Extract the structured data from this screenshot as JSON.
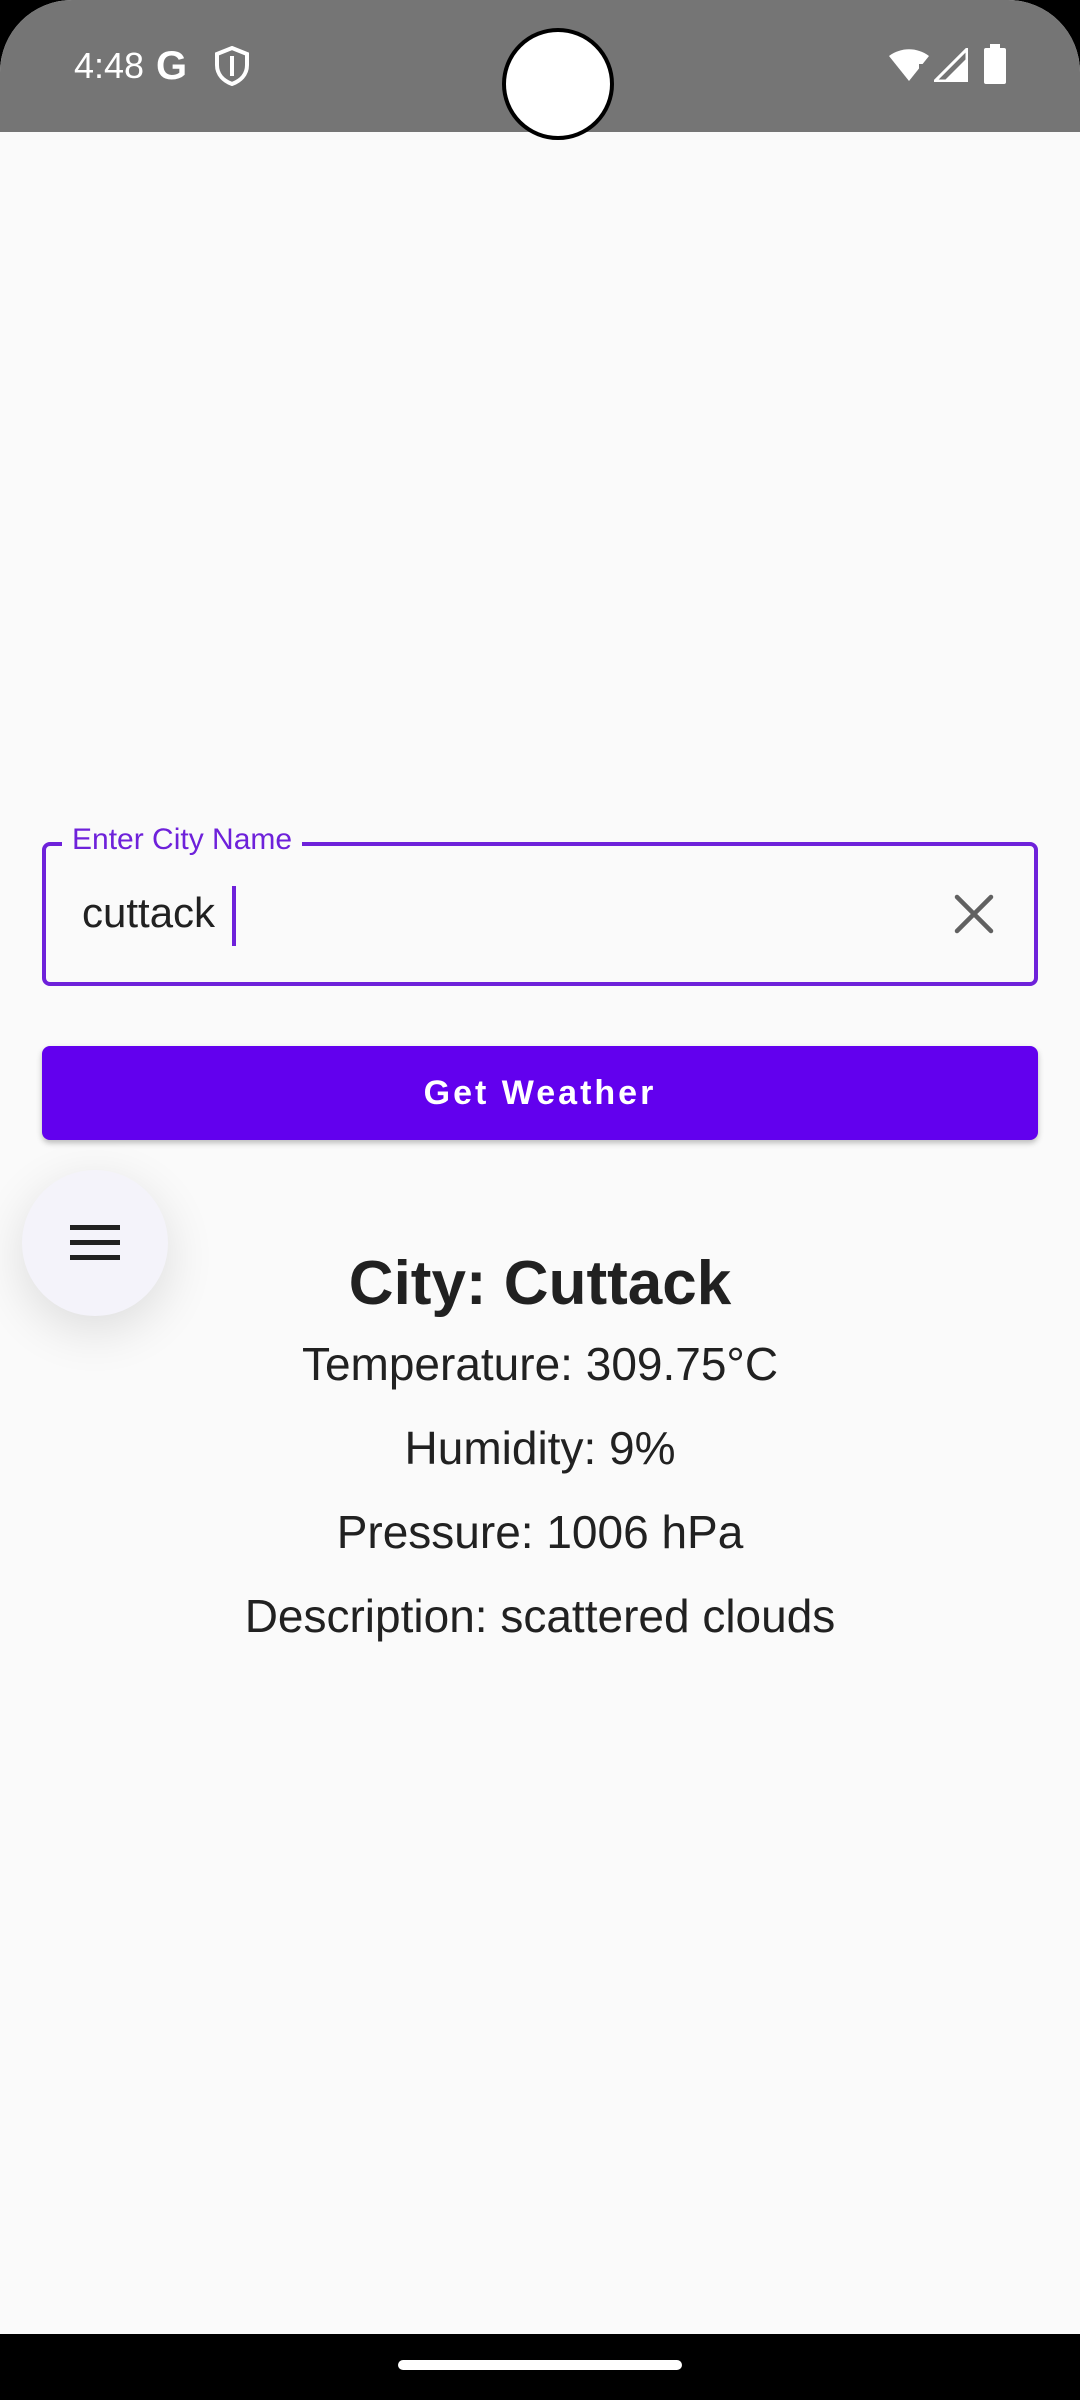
{
  "status_bar": {
    "time": "4:48",
    "g_logo": "G",
    "icons": [
      "google-g-icon",
      "shield-icon",
      "wifi-icon",
      "signal-icon",
      "battery-icon"
    ],
    "background": "#757575"
  },
  "form": {
    "city_label": "Enter City Name",
    "city_value": "cuttack",
    "clear_icon": "close-icon",
    "button_label": "Get Weather",
    "accent_color": "#6200ee"
  },
  "fab": {
    "icon": "menu-icon"
  },
  "weather": {
    "city": "City: Cuttack",
    "temperature": "Temperature: 309.75°C",
    "humidity": "Humidity: 9%",
    "pressure": "Pressure: 1006 hPa",
    "description": "Description: scattered clouds"
  },
  "navigation": {
    "handle": "home-gesture-handle"
  }
}
